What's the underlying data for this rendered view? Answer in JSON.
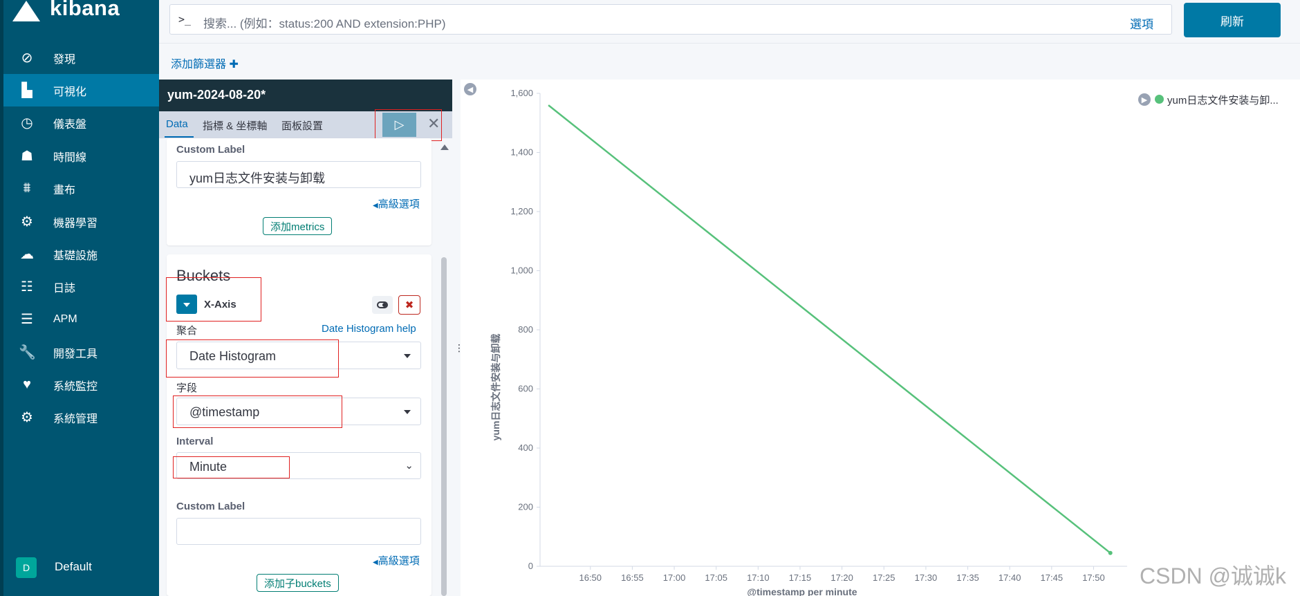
{
  "sidebar": {
    "logo": "kibana",
    "items": [
      {
        "label": "發現",
        "icon": "compass-icon"
      },
      {
        "label": "可視化",
        "icon": "bar-chart-icon",
        "active": true
      },
      {
        "label": "儀表盤",
        "icon": "gauge-icon"
      },
      {
        "label": "時間線",
        "icon": "timeline-mask-icon"
      },
      {
        "label": "畫布",
        "icon": "canvas-icon"
      },
      {
        "label": "機器學習",
        "icon": "machine-learning-icon"
      },
      {
        "label": "基礎設施",
        "icon": "infrastructure-icon"
      },
      {
        "label": "日誌",
        "icon": "logs-icon"
      },
      {
        "label": "APM",
        "icon": "apm-icon"
      },
      {
        "label": "開發工具",
        "icon": "wrench-icon"
      },
      {
        "label": "系統監控",
        "icon": "heartbeat-icon"
      },
      {
        "label": "系統管理",
        "icon": "gear-icon"
      }
    ],
    "space_badge": "D",
    "space_label": "Default"
  },
  "search": {
    "prompt": ">_",
    "placeholder": "搜索... (例如：status:200 AND extension:PHP)",
    "options_label": "選項",
    "refresh_label": "刷新"
  },
  "filter": {
    "add_label": "添加篩選器"
  },
  "editor": {
    "title": "yum-2024-08-20*",
    "tabs": [
      "Data",
      "指標 & 坐標軸",
      "面板設置"
    ],
    "metrics": {
      "custom_label_title": "Custom Label",
      "custom_label_value": "yum日志文件安装与卸载",
      "advanced_link": "高級選項",
      "add_button": "添加metrics"
    },
    "buckets": {
      "title": "Buckets",
      "axis_label": "X-Axis",
      "agg_label": "聚合",
      "agg_help": "Date Histogram help",
      "agg_value": "Date Histogram",
      "field_label": "字段",
      "field_value": "@timestamp",
      "interval_label": "Interval",
      "interval_value": "Minute",
      "custom_label_title": "Custom Label",
      "custom_label_value": "",
      "advanced_link": "高級選項",
      "add_button": "添加子buckets"
    }
  },
  "chart_data": {
    "type": "line",
    "x": [
      "17:47"
    ],
    "ylabel": "yum日志文件安装与卸载",
    "xlabel": "@timestamp per minute",
    "yticks": [
      0,
      200,
      400,
      600,
      800,
      1000,
      1200,
      1400,
      1600
    ],
    "xticks": [
      "16:50",
      "16:55",
      "17:00",
      "17:05",
      "17:10",
      "17:15",
      "17:20",
      "17:25",
      "17:30",
      "17:35",
      "17:40",
      "17:45",
      "17:50"
    ],
    "ylim": [
      0,
      1600
    ],
    "series": [
      {
        "name": "yum日志文件安装与卸...",
        "points": [
          [
            "16:45",
            1560
          ],
          [
            "17:52",
            45
          ]
        ]
      }
    ],
    "legend": "top-right",
    "color": "#57c17b"
  },
  "watermark": "CSDN @诚诚k"
}
